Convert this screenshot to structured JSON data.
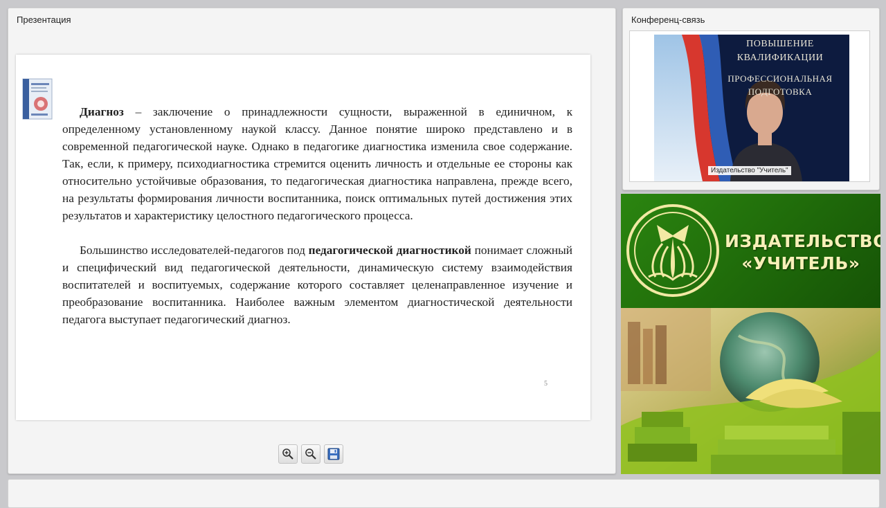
{
  "presentation": {
    "title": "Презентация",
    "slide": {
      "p1_term": "Диагноз",
      "p1_text": " – заключение о принадлежности сущности, выраженной в единичном, к определенному установленному наукой классу. Данное понятие широко представлено и в современной педагогической науке. Однако в педагогике диагностика изменила свое содержание. Так, если, к примеру, психодиагностика стремится оценить личность и отдельные ее стороны как относительно устойчивые образования, то педагогическая диагностика направлена, прежде всего, на результаты формирования личности воспитанника, поиск оптимальных путей достижения этих результатов и характеристику целостного педагогического процесса.",
      "p2_before": "Большинство исследователей-педагогов под ",
      "p2_term": "педагогической диагностикой",
      "p2_after": " понимает сложный и специфический вид педагогической деятельности, динамическую систему взаимодействия воспитателей и воспитуемых, содержание которого составляет целенаправленное изучение и преобразование воспитанника. Наиболее важным элементом диагностической деятельности педагога выступает педагогический диагноз.",
      "page_number": "5"
    },
    "toolbar": {
      "zoom_in_icon": "zoom-in-icon",
      "zoom_out_icon": "zoom-out-icon",
      "save_icon": "floppy-disk-icon"
    }
  },
  "conference": {
    "title": "Конференц-связь",
    "banner": {
      "line1": "ПОВЫШЕНИЕ",
      "line2": "КВАЛИФИКАЦИИ",
      "line3": "ПРОФЕССИОНАЛЬНАЯ",
      "line4": "ПОДГОТОВКА"
    },
    "caption": "Издательство \"Учитель\""
  },
  "brand": {
    "name_line1": "ИЗДАТЕЛЬСТВО",
    "name_line2": "«УЧИТЕЛЬ»"
  },
  "colors": {
    "brand_green": "#1f6a0a",
    "brand_gold": "#f7f0b8"
  }
}
